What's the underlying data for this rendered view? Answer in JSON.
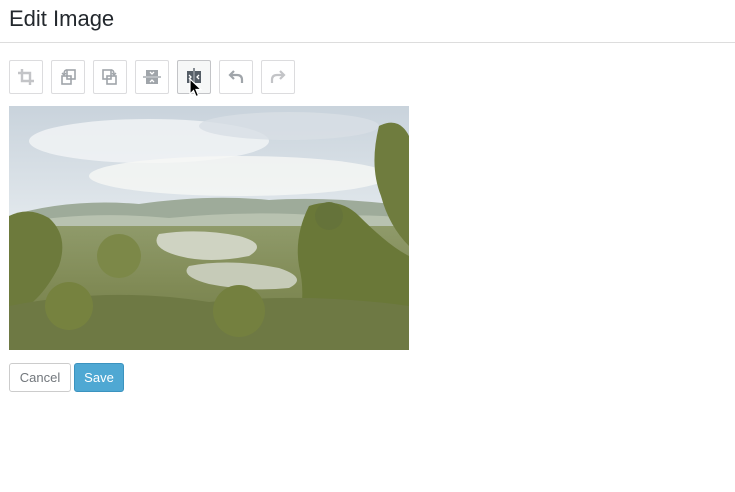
{
  "header": {
    "title": "Edit Image"
  },
  "toolbar": {
    "tools": [
      {
        "name": "crop",
        "icon": "crop-icon"
      },
      {
        "name": "rotate-left",
        "icon": "rotate-left-icon"
      },
      {
        "name": "rotate-right",
        "icon": "rotate-right-icon"
      },
      {
        "name": "flip-vertical",
        "icon": "flip-vertical-icon"
      },
      {
        "name": "flip-horizontal",
        "icon": "flip-horizontal-icon"
      },
      {
        "name": "undo",
        "icon": "undo-icon"
      },
      {
        "name": "redo",
        "icon": "redo-icon"
      }
    ]
  },
  "image": {
    "subject": "jungle-landscape"
  },
  "actions": {
    "cancel_label": "Cancel",
    "save_label": "Save"
  },
  "colors": {
    "save_button": "#4fa8d3",
    "icon_active": "#555d66",
    "icon_inactive": "#a0a5aa",
    "icon_disabled": "#c3c4c7"
  }
}
